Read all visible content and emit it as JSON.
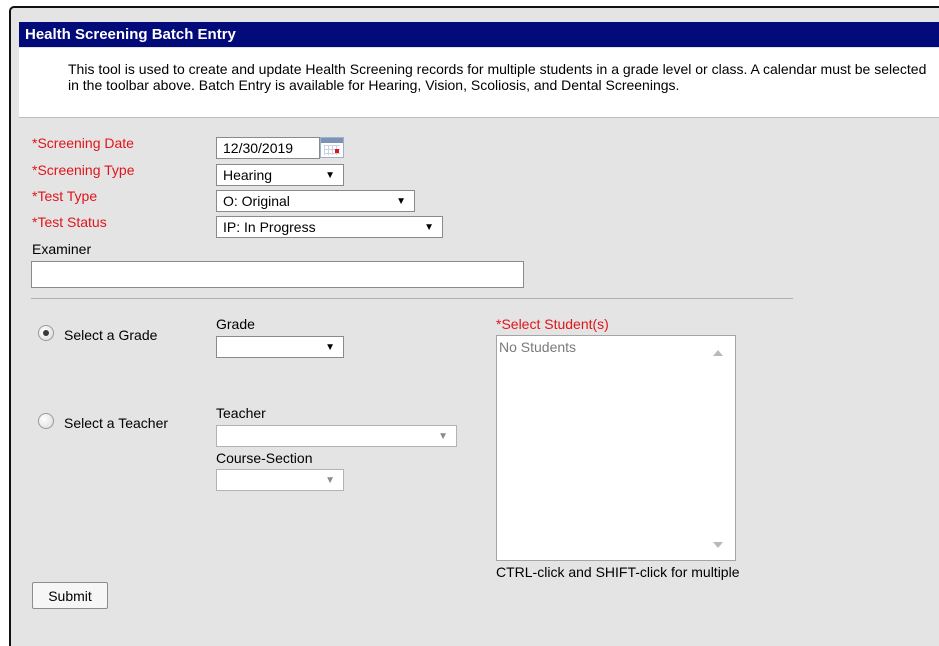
{
  "page": {
    "title": "Health Screening Batch Entry",
    "description": "This tool is used to create and update Health Screening records for multiple students in a grade level or class. A calendar must be selected in the toolbar above. Batch Entry is available for Hearing, Vision, Scoliosis, and Dental Screenings."
  },
  "form": {
    "screening_date": {
      "label": "*Screening Date",
      "value": "12/30/2019",
      "icon": "calendar-icon"
    },
    "screening_type": {
      "label": "*Screening Type",
      "value": "Hearing"
    },
    "test_type": {
      "label": "*Test Type",
      "value": "O: Original"
    },
    "test_status": {
      "label": "*Test Status",
      "value": "IP: In Progress"
    },
    "examiner": {
      "label": "Examiner",
      "value": ""
    }
  },
  "selection": {
    "grade_option": {
      "label": "Select a Grade",
      "selected": true
    },
    "grade": {
      "label": "Grade",
      "value": ""
    },
    "teacher_option": {
      "label": "Select a Teacher",
      "selected": false
    },
    "teacher": {
      "label": "Teacher",
      "value": ""
    },
    "course_section": {
      "label": "Course-Section",
      "value": ""
    },
    "students": {
      "label": "*Select Student(s)",
      "items": [
        "No Students"
      ],
      "hint": "CTRL-click and SHIFT-click for multiple"
    }
  },
  "actions": {
    "submit_label": "Submit"
  },
  "colors": {
    "header": "#030a7a",
    "required": "#e0151b",
    "panel": "#e4e4e4"
  }
}
